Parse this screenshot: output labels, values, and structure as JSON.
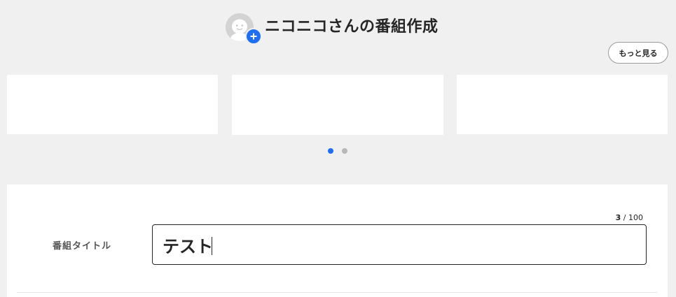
{
  "header": {
    "title": "ニコニコさんの番組作成",
    "avatar_icon": "user-avatar-icon",
    "add_icon": "plus-icon",
    "more_button_label": "もっと見る"
  },
  "carousel": {
    "card_count": 3,
    "pagination": {
      "total_pages": 2,
      "active_page": 1
    }
  },
  "form": {
    "title_field": {
      "label": "番組タイトル",
      "value": "テスト",
      "char_count": "3",
      "separator": "/",
      "max_length": "100"
    }
  },
  "colors": {
    "page_background": "#f0f0f0",
    "panel_background": "#ffffff",
    "accent_blue": "#1f6ff2",
    "text_dark": "#252525",
    "inactive_dot": "#b7b7b7"
  }
}
